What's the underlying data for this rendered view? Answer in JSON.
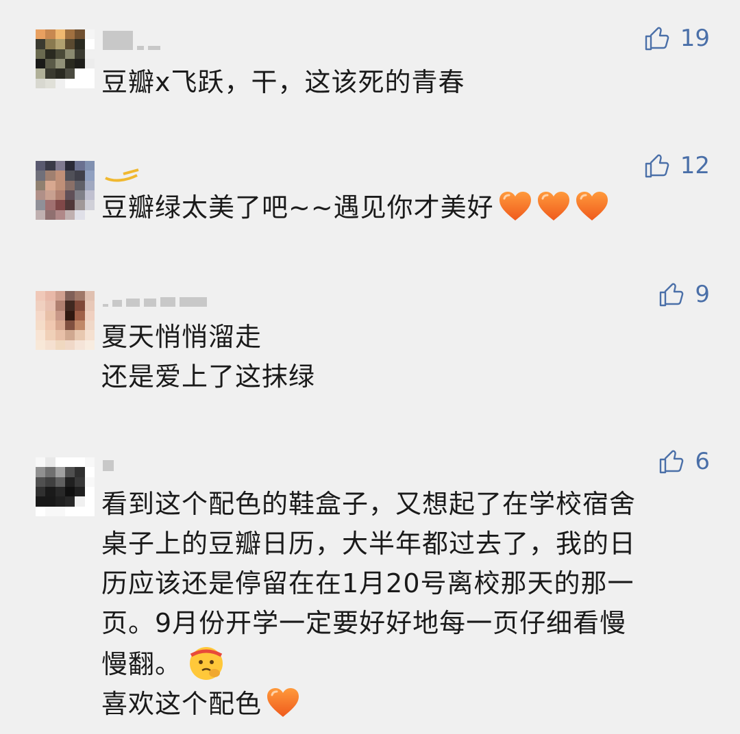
{
  "comments": [
    {
      "likes": "19",
      "lines": [
        "豆瓣x飞跃，干，这该死的青春"
      ],
      "avatar_colors": [
        "#e8a060",
        "#c88850",
        "#f0b870",
        "#a07040",
        "#705030",
        "#f5f5f5",
        "#3a3a30",
        "#8a7a50",
        "#b0a070",
        "#5a4a30",
        "#2a2a20",
        "#ffffff",
        "#6a6a50",
        "#2a2a20",
        "#4a4a38",
        "#8a8a70",
        "#3a3a30",
        "#f0f0f0",
        "#1a1a18",
        "#5a5a48",
        "#909078",
        "#2a2a20",
        "#1e1e1a",
        "#ececec",
        "#b0b098",
        "#3a3a30",
        "#2a2a22",
        "#4a4a40",
        "#ffffff",
        "#ffffff",
        "#d8d8d0",
        "#e0e0d8",
        "#f0f0f0",
        "#ffffff",
        "#ffffff",
        "#ffffff"
      ],
      "heart_count": 0,
      "face": false
    },
    {
      "likes": "12",
      "lines": [
        "豆瓣绿太美了吧~~遇见你才美好"
      ],
      "avatar_colors": [
        "#5a5a70",
        "#3a3a48",
        "#807a90",
        "#2a2a38",
        "#6a7090",
        "#8090b0",
        "#70707a",
        "#a08070",
        "#c09078",
        "#505058",
        "#40404a",
        "#90a0c0",
        "#908070",
        "#d8a890",
        "#c09078",
        "#8a7068",
        "#606068",
        "#a0a8c0",
        "#b09088",
        "#c8a090",
        "#b08070",
        "#605058",
        "#808088",
        "#c0c0d0",
        "#909098",
        "#a07070",
        "#804848",
        "#503838",
        "#a09898",
        "#d0d0d8",
        "#c0b0b0",
        "#907070",
        "#b08888",
        "#c0b0b0",
        "#e0e0e8",
        "#f0f0f0"
      ],
      "heart_count": 3,
      "face": false
    },
    {
      "likes": "9",
      "lines": [
        "夏天悄悄溜走",
        "还是爱上了这抹绿"
      ],
      "avatar_colors": [
        "#f0c8b8",
        "#e8b8a8",
        "#d0a090",
        "#806058",
        "#a07868",
        "#e0c0b0",
        "#f0d0c0",
        "#e8c0b0",
        "#b08070",
        "#402820",
        "#804838",
        "#e8c8b8",
        "#f5d8c8",
        "#e8c0a8",
        "#c89888",
        "#301810",
        "#a06048",
        "#f0d0c0",
        "#f5dcc8",
        "#f0c8b0",
        "#d8a890",
        "#805040",
        "#c08868",
        "#f0d8c8",
        "#f8e4d4",
        "#f0d0b8",
        "#e8c0a8",
        "#d0a890",
        "#e8c8b0",
        "#f5e0d0",
        "#f8e8d8",
        "#f5e0d0",
        "#f0d8c0",
        "#f0d8c8",
        "#f5e4d8",
        "#f8ece0"
      ],
      "heart_count": 0,
      "face": false
    },
    {
      "likes": "6",
      "lines": [
        "看到这个配色的鞋盒子，又想起了在学校宿舍",
        "桌子上的豆瓣日历，大半年都过去了，我的日",
        "历应该还是停留在在1月20号离校那天的那一",
        "页。9月份开学一定要好好地每一页仔细看慢",
        "慢翻。",
        "喜欢这个配色"
      ],
      "avatar_colors": [
        "#f8f8f8",
        "#e8e8e8",
        "#ffffff",
        "#ffffff",
        "#ffffff",
        "#f8f8f8",
        "#909090",
        "#707070",
        "#a0a0a0",
        "#505050",
        "#303030",
        "#ffffff",
        "#505050",
        "#404040",
        "#606060",
        "#202020",
        "#383838",
        "#f8f8f8",
        "#303030",
        "#1a1a1a",
        "#282828",
        "#101010",
        "#202020",
        "#ffffff",
        "#181818",
        "#181818",
        "#202020",
        "#282828",
        "#f0f0f0",
        "#ffffff",
        "#ffffff",
        "#f8f8f8",
        "#f8f8f8",
        "#ffffff",
        "#ffffff",
        "#ffffff"
      ],
      "heart_count": 0,
      "face": true
    }
  ]
}
